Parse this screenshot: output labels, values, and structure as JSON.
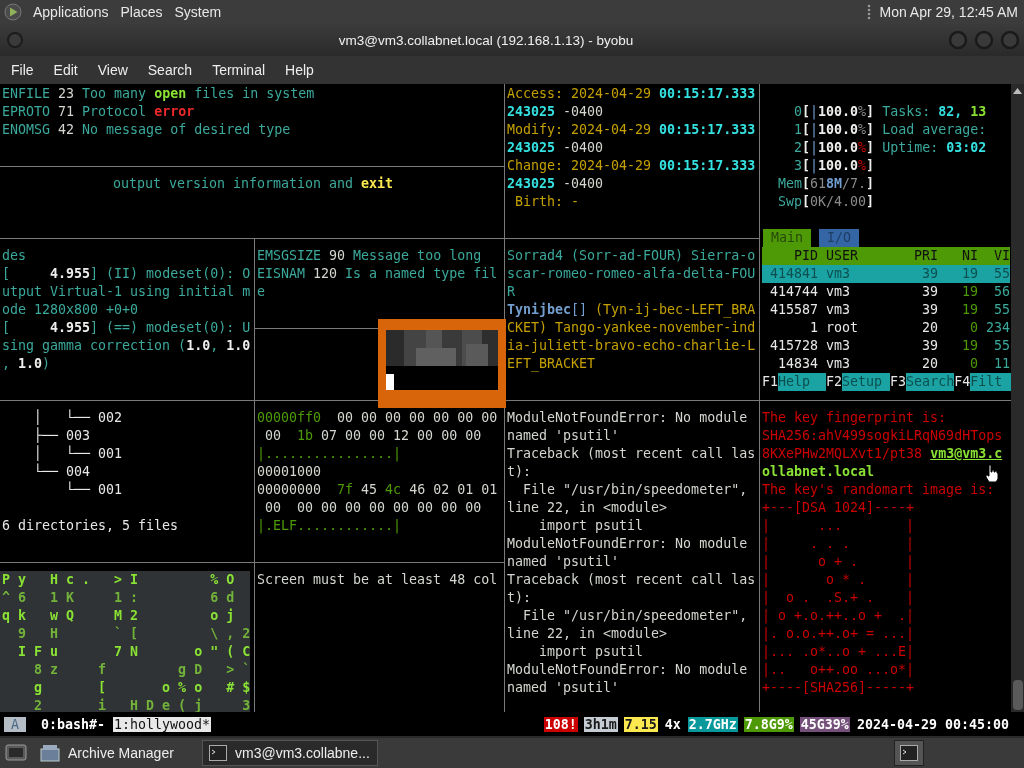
{
  "top_panel": {
    "menus": [
      "Applications",
      "Places",
      "System"
    ],
    "clock": "Mon Apr 29, 12:45 AM"
  },
  "window": {
    "title": "vm3@vm3.collabnet.local (192.168.1.13) - byobu",
    "menu": [
      "File",
      "Edit",
      "View",
      "Search",
      "Terminal",
      "Help"
    ]
  },
  "errors": {
    "lines": [
      [
        {
          "text": "ENFILE",
          "kind": "desc"
        },
        {
          "text": " 23 ",
          "kind": "num"
        },
        {
          "text": "Too many ",
          "kind": "desc"
        },
        {
          "text": "open",
          "kind": "ok"
        },
        {
          "text": " files in system",
          "kind": "desc"
        }
      ],
      [
        {
          "text": "EPROTO",
          "kind": "desc"
        },
        {
          "text": " 71 ",
          "kind": "num"
        },
        {
          "text": "Protocol ",
          "kind": "desc"
        },
        {
          "text": "error",
          "kind": "error"
        }
      ],
      [
        {
          "text": "ENOMSG",
          "kind": "desc"
        },
        {
          "text": " 42 ",
          "kind": "num"
        },
        {
          "text": "No message of desired type",
          "kind": "desc"
        }
      ]
    ]
  },
  "version": {
    "lines": [
      [
        {
          "text": "output version information and ",
          "kind": "desc"
        },
        {
          "text": "exit",
          "kind": "warn"
        }
      ]
    ]
  },
  "stat": {
    "lines": [
      [
        {
          "text": "Access: 2024-04-29 ",
          "kind": "date"
        },
        {
          "text": "00:15:17.333",
          "kind": "time"
        }
      ],
      [
        {
          "text": "243025",
          "kind": "time"
        },
        {
          "text": " -0400",
          "kind": "num"
        }
      ],
      [
        {
          "text": "Modify: 2024-04-29 ",
          "kind": "date"
        },
        {
          "text": "00:15:17.333",
          "kind": "time"
        }
      ],
      [
        {
          "text": "243025",
          "kind": "time"
        },
        {
          "text": " -0400",
          "kind": "num"
        }
      ],
      [
        {
          "text": "Change: 2024-04-29 ",
          "kind": "date"
        },
        {
          "text": "00:15:17.333",
          "kind": "time"
        }
      ],
      [
        {
          "text": "243025",
          "kind": "time"
        },
        {
          "text": " -0400",
          "kind": "num"
        }
      ],
      " Birth: -"
    ]
  },
  "htop": {
    "meters": [
      [
        {
          "text": "    0",
          "kind": "desc"
        },
        {
          "text": "[",
          "kind": "strong"
        },
        {
          "text": "|",
          "kind": "bracket"
        },
        {
          "text": "100.0",
          "kind": "strong"
        },
        {
          "text": "%",
          "kind": "muted"
        },
        {
          "text": "]",
          "kind": "strong"
        },
        {
          "text": " Tasks: ",
          "kind": "desc"
        },
        {
          "text": "82, ",
          "kind": "time"
        },
        {
          "text": "13",
          "kind": "ok"
        }
      ],
      [
        {
          "text": "    1",
          "kind": "desc"
        },
        {
          "text": "[",
          "kind": "strong"
        },
        {
          "text": "|",
          "kind": "bracket"
        },
        {
          "text": "100.0",
          "kind": "strong"
        },
        {
          "text": "%",
          "kind": "muted"
        },
        {
          "text": "]",
          "kind": "strong"
        },
        {
          "text": " Load average:",
          "kind": "desc"
        }
      ],
      [
        {
          "text": "    2",
          "kind": "desc"
        },
        {
          "text": "[",
          "kind": "strong"
        },
        {
          "text": "|",
          "kind": "bracket"
        },
        {
          "text": "100.0",
          "kind": "strong"
        },
        {
          "text": "%",
          "kind": "alert"
        },
        {
          "text": "]",
          "kind": "strong"
        },
        {
          "text": " Uptime: ",
          "kind": "desc"
        },
        {
          "text": "03:02",
          "kind": "time"
        }
      ],
      [
        {
          "text": "    3",
          "kind": "desc"
        },
        {
          "text": "[",
          "kind": "strong"
        },
        {
          "text": "|",
          "kind": "bracket"
        },
        {
          "text": "100.0",
          "kind": "strong"
        },
        {
          "text": "%",
          "kind": "alert"
        },
        {
          "text": "]",
          "kind": "strong"
        }
      ],
      [
        {
          "text": "  Mem",
          "kind": "desc"
        },
        {
          "text": "[",
          "kind": "strong"
        },
        {
          "text": "61",
          "kind": "muted"
        },
        {
          "text": "8M",
          "kind": "name"
        },
        {
          "text": "/7.",
          "kind": "muted"
        },
        {
          "text": "]",
          "kind": "strong"
        }
      ],
      [
        {
          "text": "  Swp",
          "kind": "desc"
        },
        {
          "text": "[",
          "kind": "strong"
        },
        {
          "text": "0K/4.00",
          "kind": "muted"
        },
        {
          "text": "]",
          "kind": "strong"
        }
      ]
    ],
    "tabs": [
      {
        "label": "Main",
        "selected": true
      },
      {
        "label": "I/O",
        "selected": false
      }
    ],
    "columns": [
      "PID",
      "USER",
      "PRI",
      "NI",
      "VI"
    ],
    "processes": [
      {
        "pid": "414841",
        "user": "vm3",
        "pri": "39",
        "ni": "19",
        "virt": "55",
        "selected": true
      },
      {
        "pid": "414744",
        "user": "vm3",
        "pri": "39",
        "ni": "19",
        "virt": "56",
        "selected": false
      },
      {
        "pid": "415587",
        "user": "vm3",
        "pri": "39",
        "ni": "19",
        "virt": "55",
        "selected": false
      },
      {
        "pid": "1",
        "user": "root",
        "pri": "20",
        "ni": "0",
        "virt": "234",
        "selected": false
      },
      {
        "pid": "415728",
        "user": "vm3",
        "pri": "39",
        "ni": "19",
        "virt": "55",
        "selected": false
      },
      {
        "pid": "14834",
        "user": "vm3",
        "pri": "20",
        "ni": "0",
        "virt": "11",
        "selected": false
      }
    ],
    "function_keys": [
      {
        "key": "F1",
        "label": "Help"
      },
      {
        "key": "F2",
        "label": "Setup"
      },
      {
        "key": "F3",
        "label": "Search"
      },
      {
        "key": "F4",
        "label": "Filt"
      }
    ]
  },
  "kernel_log": {
    "lines": [
      "des",
      [
        {
          "text": "[     ",
          "kind": "desc"
        },
        {
          "text": "4.955",
          "kind": "strong"
        },
        {
          "text": "] (II) modeset(0): O",
          "kind": "desc"
        }
      ],
      "utput Virtual-1 using initial m",
      "ode 1280x800 +0+0",
      [
        {
          "text": "[     ",
          "kind": "desc"
        },
        {
          "text": "4.955",
          "kind": "strong"
        },
        {
          "text": "] (==) modeset(0): U",
          "kind": "desc"
        }
      ],
      [
        {
          "text": "sing gamma correction (",
          "kind": "desc"
        },
        {
          "text": "1.0",
          "kind": "strong"
        },
        {
          "text": ", ",
          "kind": "desc"
        },
        {
          "text": "1.0",
          "kind": "strong"
        }
      ],
      [
        {
          "text": ", ",
          "kind": "desc"
        },
        {
          "text": "1.0",
          "kind": "strong"
        },
        {
          "text": ")",
          "kind": "desc"
        }
      ]
    ]
  },
  "errors_2": {
    "lines": [
      [
        {
          "text": "EMSGSIZE",
          "kind": "desc"
        },
        {
          "text": " 90 ",
          "kind": "num"
        },
        {
          "text": "Message too long",
          "kind": "desc"
        }
      ],
      [
        {
          "text": "EISNAM",
          "kind": "desc"
        },
        {
          "text": " 120 ",
          "kind": "num"
        },
        {
          "text": "Is a named type fil",
          "kind": "desc"
        }
      ],
      "e"
    ]
  },
  "spelling": {
    "lines": [
      "Sorrad4 (Sorr-ad-FOUR) Sierra-o",
      "scar-romeo-romeo-alfa-delta-FOU",
      "R",
      [
        {
          "text": "Tynijbec",
          "kind": "name"
        },
        {
          "text": "[]",
          "kind": "bracket"
        },
        {
          "text": " (Tyn-ij-bec-LEFT_BRA",
          "kind": "date"
        }
      ],
      [
        {
          "text": "CKET) Tango-yankee-november-ind",
          "kind": "date"
        }
      ],
      [
        {
          "text": "ia-juliett-bravo-echo-charlie-L",
          "kind": "date"
        }
      ],
      [
        {
          "text": "EFT_BRACKET",
          "kind": "date"
        }
      ]
    ]
  },
  "tree": {
    "lines": [
      "    │   └── 002",
      "    ├── 003",
      "    │   └── 001",
      "    └── 004",
      "        └── 001"
    ],
    "summary": "6 directories, 5 files"
  },
  "hexdump": {
    "lines": [
      [
        {
          "text": "00000ff0",
          "kind": "offset"
        },
        {
          "text": "  00 00 00 00 00 00 00",
          "kind": "num"
        }
      ],
      [
        {
          "text": " 00  ",
          "kind": "num"
        },
        {
          "text": "1b",
          "kind": "offset"
        },
        {
          "text": " 07 00 00 12 00 00 00",
          "kind": "num"
        }
      ],
      [
        {
          "text": "|................|",
          "kind": "offset"
        }
      ],
      "00001000",
      [
        {
          "text": "00000000  ",
          "kind": "num"
        },
        {
          "text": "7f",
          "kind": "offset"
        },
        {
          "text": " 45 ",
          "kind": "num"
        },
        {
          "text": "4c",
          "kind": "offset"
        },
        {
          "text": " 46 02 01 01",
          "kind": "num"
        }
      ],
      " 00  00 00 00 00 00 00 00 00",
      [
        {
          "text": "|.ELF............|",
          "kind": "offset"
        }
      ]
    ]
  },
  "traceback": {
    "lines": [
      "ModuleNotFoundError: No module",
      "named 'psutil'",
      "Traceback (most recent call las",
      "t):",
      "  File \"/usr/bin/speedometer\",",
      "line 22, in <module>",
      "    import psutil",
      "ModuleNotFoundError: No module",
      "named 'psutil'",
      "Traceback (most recent call las",
      "t):",
      "  File \"/usr/bin/speedometer\",",
      "line 22, in <module>",
      "    import psutil",
      "ModuleNotFoundError: No module",
      "named 'psutil'"
    ]
  },
  "keygen": {
    "lines": [
      "The key fingerprint is:",
      "SHA256:ahV499sogkiLRqN69dHTops",
      [
        {
          "text": "8KXePHw2MQLXvt1/pt38 ",
          "kind": "alert"
        },
        {
          "text": "vm3@vm3.c",
          "kind": "link"
        }
      ],
      [
        {
          "text": "ollabnet.local",
          "kind": "ok"
        }
      ],
      "The key's randomart image is:",
      "+---[DSA 1024]----+",
      "|      ...        |",
      "|     . . .       |",
      "|      o + .      |",
      "|       o * .     |",
      "|  o .  .S.+ .    |",
      "| o +.o.++..o +  .|",
      "|. o.o.++.o+ = ...|",
      "|... .o*..o + ...E|",
      "|..   o++.oo ...o*|",
      "+----[SHA256]-----+"
    ]
  },
  "matrix": {
    "lines": [
      "P y   H c .   > I         % O",
      "^ 6   1 K     1 :         6 d",
      "q k   w Q     M 2         o j",
      "  9   H       ` [         \\ , 2",
      "  I F u       7 N       o \" ( C",
      "    8 z     f         g D   > `",
      "    g       [       o % o   # $",
      "    2       i   H D e ( j     3"
    ]
  },
  "notice": {
    "lines": [
      "Screen must be at least 48 col"
    ]
  },
  "status_bar": {
    "session": "A",
    "windows": [
      {
        "label": "0:bash#-",
        "selected": false
      },
      {
        "label": "1:hollywood*",
        "selected": true
      }
    ],
    "indicators": [
      {
        "text": "108!",
        "color": "#cc0000"
      },
      {
        "text": "3h1m",
        "color": "#c5ccd4"
      },
      {
        "text": "7.15",
        "color": "#fce94f"
      },
      {
        "text": "4x",
        "color": "#000000"
      },
      {
        "text": "2.7GHz",
        "color": "#06989a"
      },
      {
        "text": "7.8G9%",
        "color": "#4e9a06"
      },
      {
        "text": "45G39%",
        "color": "#75507b"
      },
      {
        "text": "2024-04-29 00:45:00",
        "color": "#000000"
      }
    ]
  },
  "taskbar": {
    "tasks": [
      {
        "label": "Archive Manager",
        "selected": false
      },
      {
        "label": "vm3@vm3.collabne...",
        "selected": true
      }
    ]
  }
}
